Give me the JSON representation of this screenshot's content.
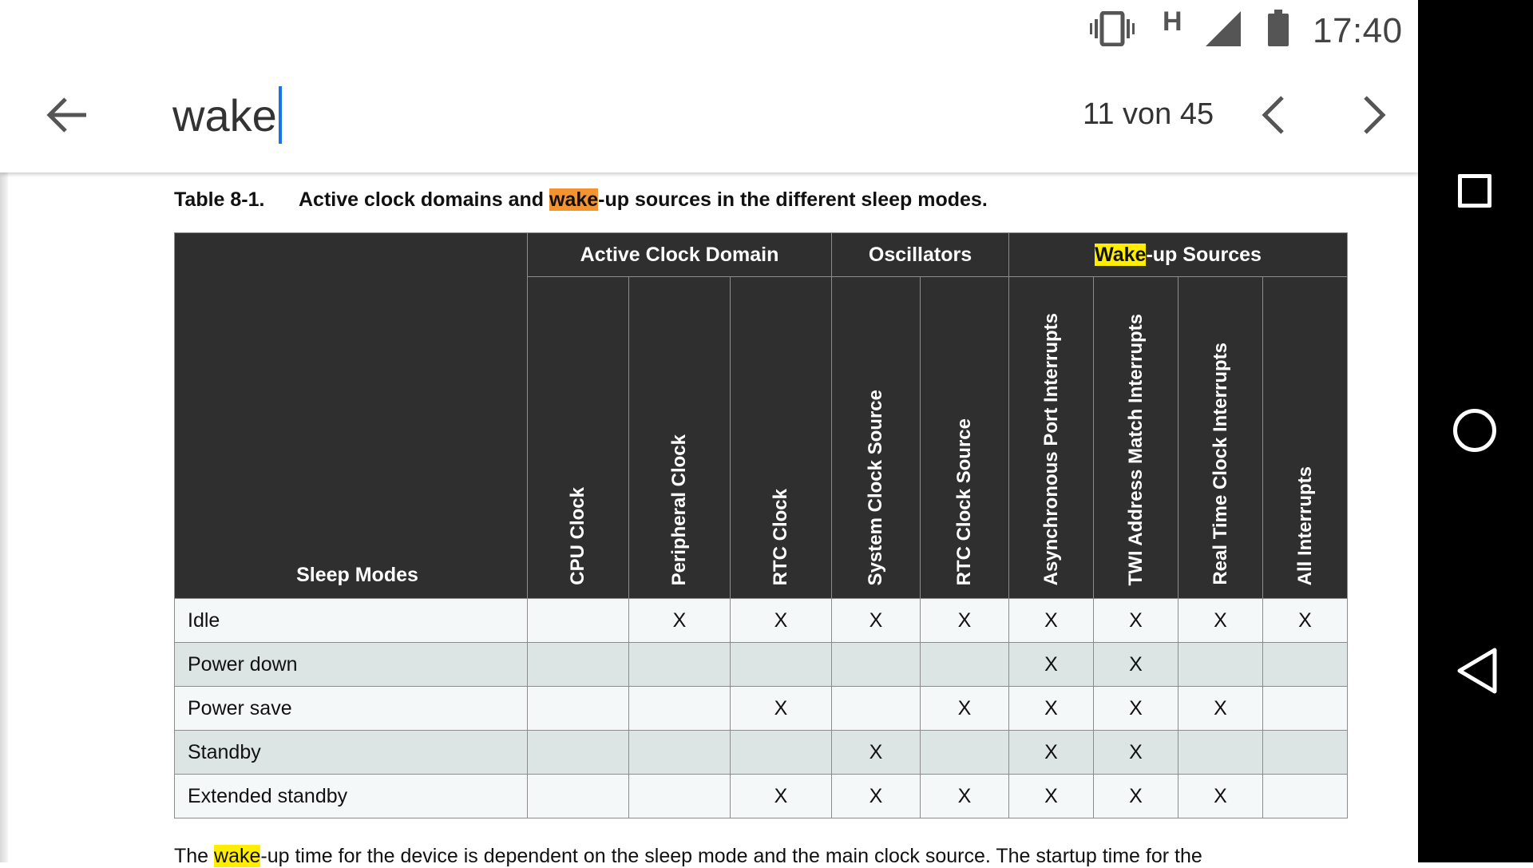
{
  "status_bar": {
    "time": "17:40",
    "network_type": "H",
    "icons": [
      "vibrate-icon",
      "signal-icon",
      "battery-icon"
    ]
  },
  "search": {
    "query": "wake",
    "match_counter": "11 von 45"
  },
  "document": {
    "caption": {
      "number": "Table 8-1.",
      "text_before": "Active clock domains and ",
      "highlight": "wake",
      "text_after": "-up sources in the different sleep modes."
    },
    "table": {
      "groups": {
        "active_clock_domain": "Active Clock Domain",
        "oscillators": "Oscillators",
        "wakeup_highlight": "Wake",
        "wakeup_rest": "-up Sources"
      },
      "sleep_modes_header": "Sleep Modes",
      "columns": [
        "CPU Clock",
        "Peripheral Clock",
        "RTC Clock",
        "System Clock Source",
        "RTC Clock Source",
        "Asynchronous Port Interrupts",
        "TWI Address Match Interrupts",
        "Real Time Clock Interrupts",
        "All Interrupts"
      ],
      "rows": [
        {
          "mode": "Idle",
          "cells": [
            "",
            "X",
            "X",
            "X",
            "X",
            "X",
            "X",
            "X",
            "X"
          ]
        },
        {
          "mode": "Power down",
          "cells": [
            "",
            "",
            "",
            "",
            "",
            "X",
            "X",
            "",
            ""
          ]
        },
        {
          "mode": "Power save",
          "cells": [
            "",
            "",
            "X",
            "",
            "X",
            "X",
            "X",
            "X",
            ""
          ]
        },
        {
          "mode": "Standby",
          "cells": [
            "",
            "",
            "",
            "X",
            "",
            "X",
            "X",
            "",
            ""
          ]
        },
        {
          "mode": "Extended standby",
          "cells": [
            "",
            "",
            "X",
            "X",
            "X",
            "X",
            "X",
            "X",
            ""
          ]
        }
      ]
    },
    "body_text": {
      "before": "The ",
      "highlight": "wake",
      "after": "-up time for the device is dependent on the sleep mode and the main clock source. The startup time for the"
    }
  },
  "colors": {
    "current_match_highlight": "#f39431",
    "other_match_highlight": "#ffee00",
    "table_header_bg": "#2f2f2f",
    "row_light": "#f4f8f8",
    "row_dark": "#dde4e4",
    "caret": "#1a73e8"
  }
}
